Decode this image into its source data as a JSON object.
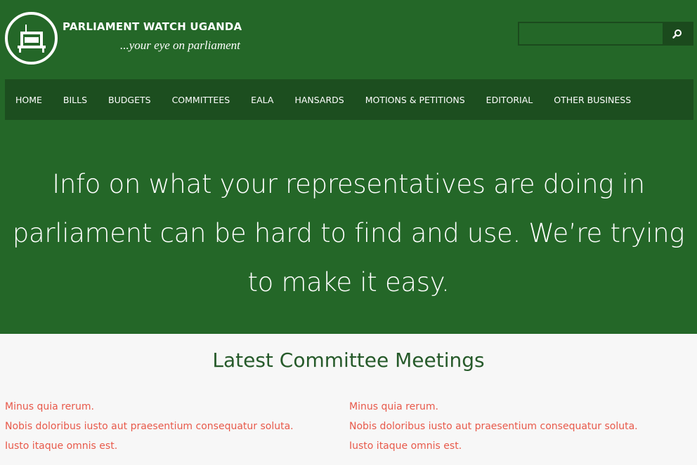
{
  "site": {
    "title": "PARLIAMENT WATCH UGANDA",
    "tagline": "...your eye on parliament",
    "logo_icon": "parliament-building-icon"
  },
  "search": {
    "placeholder": "",
    "value": "",
    "button_icon": "search-icon"
  },
  "nav": {
    "items": [
      {
        "label": "HOME"
      },
      {
        "label": "BILLS"
      },
      {
        "label": "BUDGETS"
      },
      {
        "label": "COMMITTEES"
      },
      {
        "label": "EALA"
      },
      {
        "label": "HANSARDS"
      },
      {
        "label": "MOTIONS & PETITIONS"
      },
      {
        "label": "EDITORIAL"
      },
      {
        "label": "OTHER BUSINESS"
      }
    ]
  },
  "hero": {
    "headline_line1": "Info on what your representatives are doing in",
    "headline_line2": "parliament can be hard to find and use. We’re trying",
    "headline_line3": "to make it easy."
  },
  "committee_meetings": {
    "title": "Latest Committee Meetings",
    "columns": [
      {
        "lines": [
          "Minus quia rerum.",
          "Nobis doloribus iusto aut praesentium consequatur soluta.",
          "Iusto itaque omnis est."
        ]
      },
      {
        "lines": [
          "Minus quia rerum.",
          "Nobis doloribus iusto aut praesentium consequatur soluta.",
          "Iusto itaque omnis est."
        ]
      }
    ]
  },
  "colors": {
    "hero_green": "#246728",
    "nav_green": "#1c4e1f",
    "title_green": "#265a2a",
    "link_red": "#e8594a",
    "page_bg": "#f7f7f7"
  }
}
